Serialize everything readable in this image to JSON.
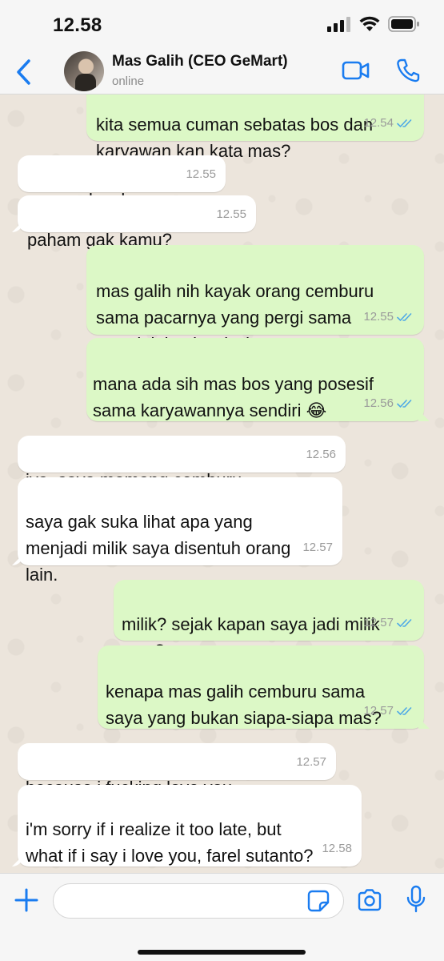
{
  "status_bar": {
    "time": "12.58"
  },
  "header": {
    "contact_name": "Mas Galih (CEO GeMart)",
    "contact_status": "online"
  },
  "messages": [
    {
      "dir": "out",
      "text": "kita semua cuman sebatas bos dan\nkaryawan kan kata mas?",
      "time": "12.54",
      "read": true
    },
    {
      "dir": "in",
      "text": "saya gak suka.",
      "time": "12.55"
    },
    {
      "dir": "in",
      "text": "paham gak kamu?",
      "time": "12.55"
    },
    {
      "dir": "out",
      "text": "mas galih nih kayak orang cemburu\nsama pacarnya yang pergi sama\ncowok lain aja wkwk",
      "time": "12.55",
      "read": true
    },
    {
      "dir": "out",
      "text": "mana ada sih mas bos yang posesif\nsama karyawannya sendiri 😂",
      "time": "12.56",
      "read": true
    },
    {
      "dir": "in",
      "text": "iya, saya memang cemburu.",
      "time": "12.56"
    },
    {
      "dir": "in",
      "text": "saya gak suka lihat apa yang\nmenjadi milik saya disentuh orang\nlain.",
      "time": "12.57"
    },
    {
      "dir": "out",
      "text": "milik? sejak kapan saya jadi milik\nmas?",
      "time": "12.57",
      "read": true
    },
    {
      "dir": "out",
      "text": "kenapa mas galih cemburu sama\nsaya yang bukan siapa-siapa mas?",
      "time": "12.57",
      "read": true
    },
    {
      "dir": "in",
      "text": "because i fucking love you.",
      "time": "12.57"
    },
    {
      "dir": "in",
      "text": "i'm sorry if i realize it too late, but\nwhat if i say i love you, farel sutanto?",
      "time": "12.58"
    }
  ],
  "input": {
    "placeholder": ""
  },
  "icons": {
    "back": "chevron-left-icon",
    "video": "video-camera-icon",
    "call": "phone-icon",
    "plus": "plus-icon",
    "sticker": "sticker-icon",
    "camera": "camera-icon",
    "mic": "microphone-icon"
  },
  "colors": {
    "accent": "#1a7cf0",
    "outgoing_bubble": "#dcf8c6",
    "incoming_bubble": "#ffffff",
    "read_ticks": "#4fa9e6",
    "chat_bg": "#ece5dc"
  }
}
